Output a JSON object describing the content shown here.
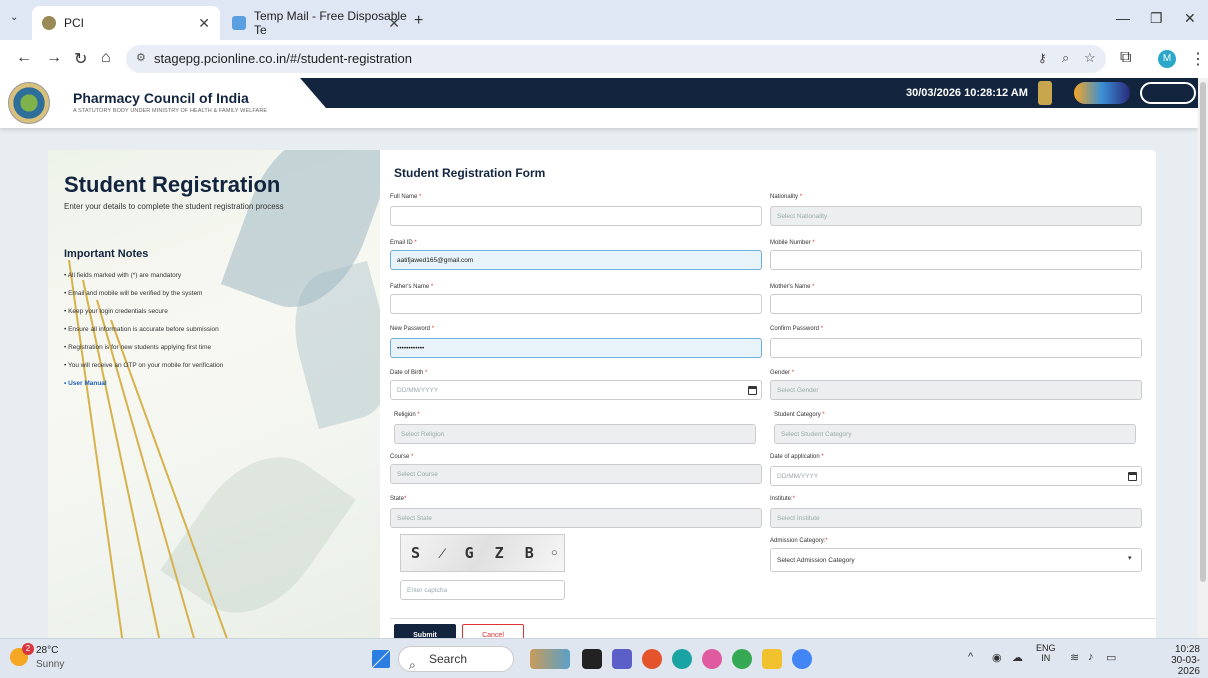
{
  "browser": {
    "tabs": [
      {
        "title": "PCI",
        "active": true
      },
      {
        "title": "Temp Mail - Free Disposable Te"
      }
    ],
    "new_tab": "+",
    "url": "stagepg.pcionline.co.in/#/student-registration",
    "profile_initial": "M"
  },
  "header": {
    "org_name": "Pharmacy Council of India",
    "org_tagline": "A STATUTORY BODY UNDER MINISTRY OF HEALTH & FAMILY WELFARE",
    "datetime": "30/03/2026 10:28:12 AM"
  },
  "left_panel": {
    "title": "Student Registration",
    "subtitle": "Enter your details to complete the student registration process",
    "notes_heading": "Important Notes",
    "notes": [
      "• All fields marked with (*) are mandatory",
      "• Email and mobile will be verified by the system",
      "• Keep your login credentials secure",
      "• Ensure all information is accurate before submission",
      "• Registration is for new students applying first time",
      "• You will receive an OTP on your mobile for verification"
    ],
    "user_manual": "• User Manual"
  },
  "form": {
    "title": "Student Registration Form",
    "full_name": {
      "label": "Full Name",
      "value": ""
    },
    "nationality": {
      "label": "Nationality",
      "placeholder": "Select Nationality"
    },
    "email": {
      "label": "Email ID",
      "value": "aatifjawed165@gmail.com"
    },
    "mobile": {
      "label": "Mobile Number",
      "value": ""
    },
    "father_name": {
      "label": "Father's Name",
      "value": ""
    },
    "mother_name": {
      "label": "Mother's Name",
      "value": ""
    },
    "new_password": {
      "label": "New Password",
      "value": "••••••••••••"
    },
    "confirm_password": {
      "label": "Confirm Password",
      "value": ""
    },
    "dob": {
      "label": "Date of Birth",
      "placeholder": "DD/MM/YYYY"
    },
    "gender": {
      "label": "Gender",
      "placeholder": "Select Gender"
    },
    "religion": {
      "label": "Religion",
      "placeholder": "Select Religion"
    },
    "student_category": {
      "label": "Student Category",
      "placeholder": "Select Student Category"
    },
    "course": {
      "label": "Course",
      "placeholder": "Select Course"
    },
    "date_of_application": {
      "label": "Date of application",
      "placeholder": "DD/MM/YYYY"
    },
    "state": {
      "label": "State",
      "placeholder": "Select State"
    },
    "institute": {
      "label": "Institute:",
      "placeholder": "Select Institute"
    },
    "admission_category": {
      "label": "Admission Category:",
      "placeholder": "Select Admission Category"
    },
    "captcha_text": "S ⁄ G Z B",
    "captcha_placeholder": "Enter captcha",
    "submit_label": "Submit",
    "cancel_label": "Cancel",
    "required_mark": "*"
  },
  "taskbar": {
    "temperature": "28°C",
    "condition": "Sunny",
    "weather_badge": "2",
    "search": "Search",
    "lang1": "ENG",
    "lang2": "IN",
    "time": "10:28",
    "date": "30-03-2026"
  },
  "colors": {
    "brand_navy": "#13243f",
    "required": "#d33",
    "link": "#1f5fb8"
  }
}
